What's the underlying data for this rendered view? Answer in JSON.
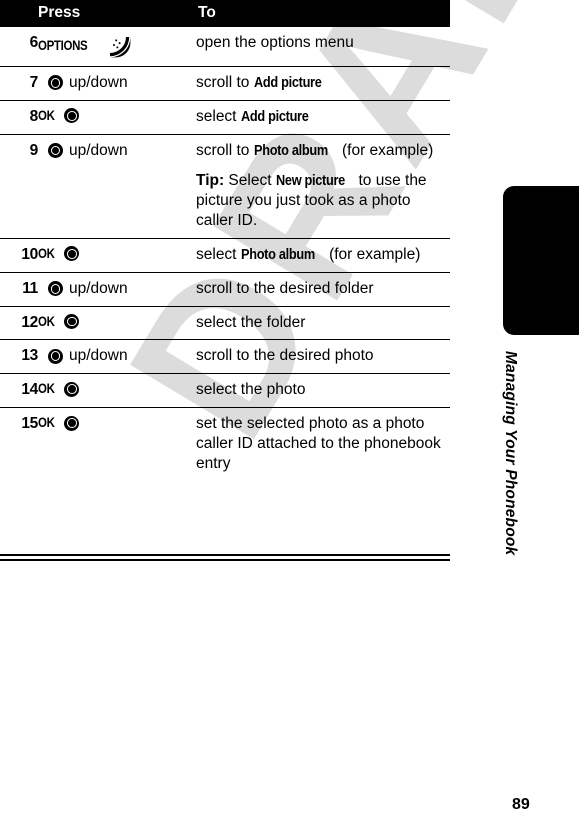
{
  "table": {
    "headers": {
      "number": "",
      "press": "Press",
      "to": "To"
    },
    "rows": [
      {
        "number": "6",
        "press_label": "OPTIONS",
        "press_icon": "options-softkey-icon",
        "to_text": "open the options menu"
      },
      {
        "number": "7",
        "press_icon": "nav-key-icon",
        "press_label": "up/down",
        "to_prefix": "scroll to ",
        "to_term": "Add picture",
        "to_suffix": ""
      },
      {
        "number": "8",
        "press_label": "OK",
        "press_icon": "nav-key-icon",
        "to_prefix": "select ",
        "to_term": "Add picture",
        "to_suffix": ""
      },
      {
        "number": "9",
        "press_icon": "nav-key-icon",
        "press_label": "up/down",
        "to_prefix": "scroll to ",
        "to_term": "Photo album",
        "to_suffix": " (for example)",
        "tip_lead": "Tip:",
        "tip_prefix": " Select ",
        "tip_term": "New picture",
        "tip_suffix": " to use the picture you just took as a photo caller ID."
      },
      {
        "number": "10",
        "press_label": "OK",
        "press_icon": "nav-key-icon",
        "to_prefix": "select ",
        "to_term": "Photo album",
        "to_suffix": " (for example)"
      },
      {
        "number": "11",
        "press_icon": "nav-key-icon",
        "press_label": "up/down",
        "to_text": "scroll to the desired folder"
      },
      {
        "number": "12",
        "press_label": "OK",
        "press_icon": "nav-key-icon",
        "to_text": "select the folder"
      },
      {
        "number": "13",
        "press_icon": "nav-key-icon",
        "press_label": "up/down",
        "to_text": "scroll to the desired photo"
      },
      {
        "number": "14",
        "press_label": "OK",
        "press_icon": "nav-key-icon",
        "to_text": "select the photo"
      },
      {
        "number": "15",
        "press_label": "OK",
        "press_icon": "nav-key-icon",
        "to_text": "set the selected photo as a photo caller ID attached to the phonebook entry"
      }
    ]
  },
  "side": {
    "chapter_title": "Managing Your Phonebook"
  },
  "footer": {
    "page_number": "89"
  },
  "watermark": {
    "text": "DRAFT",
    "color": "#dcdcdc"
  },
  "colors": {
    "header_bar": "#000000",
    "header_text": "#ffffff",
    "body_text": "#000000",
    "rule": "#000000",
    "side_tab": "#000000"
  }
}
